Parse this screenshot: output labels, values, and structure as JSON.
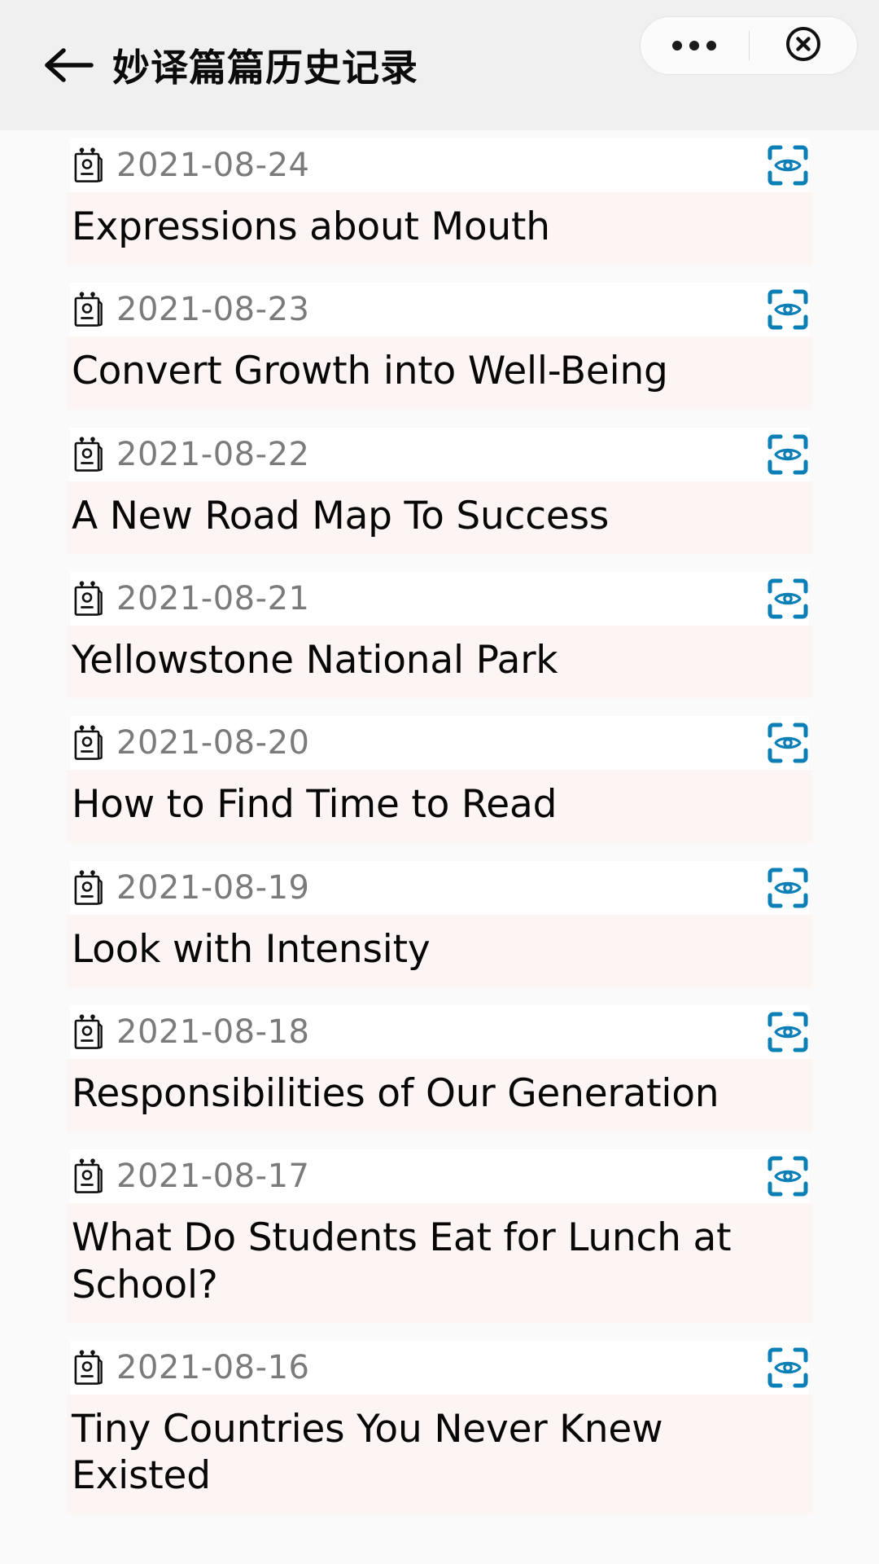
{
  "header": {
    "back_icon": "arrow-left-icon",
    "title": "妙译篇篇历史记录",
    "capsule": {
      "more_icon": "more-horizontal-icon",
      "close_icon": "close-circle-icon"
    }
  },
  "colors": {
    "header_bg": "#f0f0f0",
    "page_bg": "#fafafa",
    "date_row_bg": "#ffffff",
    "title_row_bg": "#fdf5f4",
    "date_text": "#7b7b7b",
    "title_text": "#070707",
    "scan_icon": "#0d7fb7"
  },
  "list": {
    "date_icon": "memo-pad-icon",
    "action_icon": "eye-scan-icon",
    "items": [
      {
        "date": "2021-08-24",
        "title": "Expressions about Mouth"
      },
      {
        "date": "2021-08-23",
        "title": "Convert Growth into Well-Being"
      },
      {
        "date": "2021-08-22",
        "title": "A New Road Map To Success"
      },
      {
        "date": "2021-08-21",
        "title": "Yellowstone National Park"
      },
      {
        "date": "2021-08-20",
        "title": "How to Find Time to Read"
      },
      {
        "date": "2021-08-19",
        "title": "Look with Intensity"
      },
      {
        "date": "2021-08-18",
        "title": "Responsibilities of Our Generation"
      },
      {
        "date": "2021-08-17",
        "title": "What Do Students Eat for Lunch at School?"
      },
      {
        "date": "2021-08-16",
        "title": "Tiny Countries You Never Knew Existed"
      }
    ]
  }
}
